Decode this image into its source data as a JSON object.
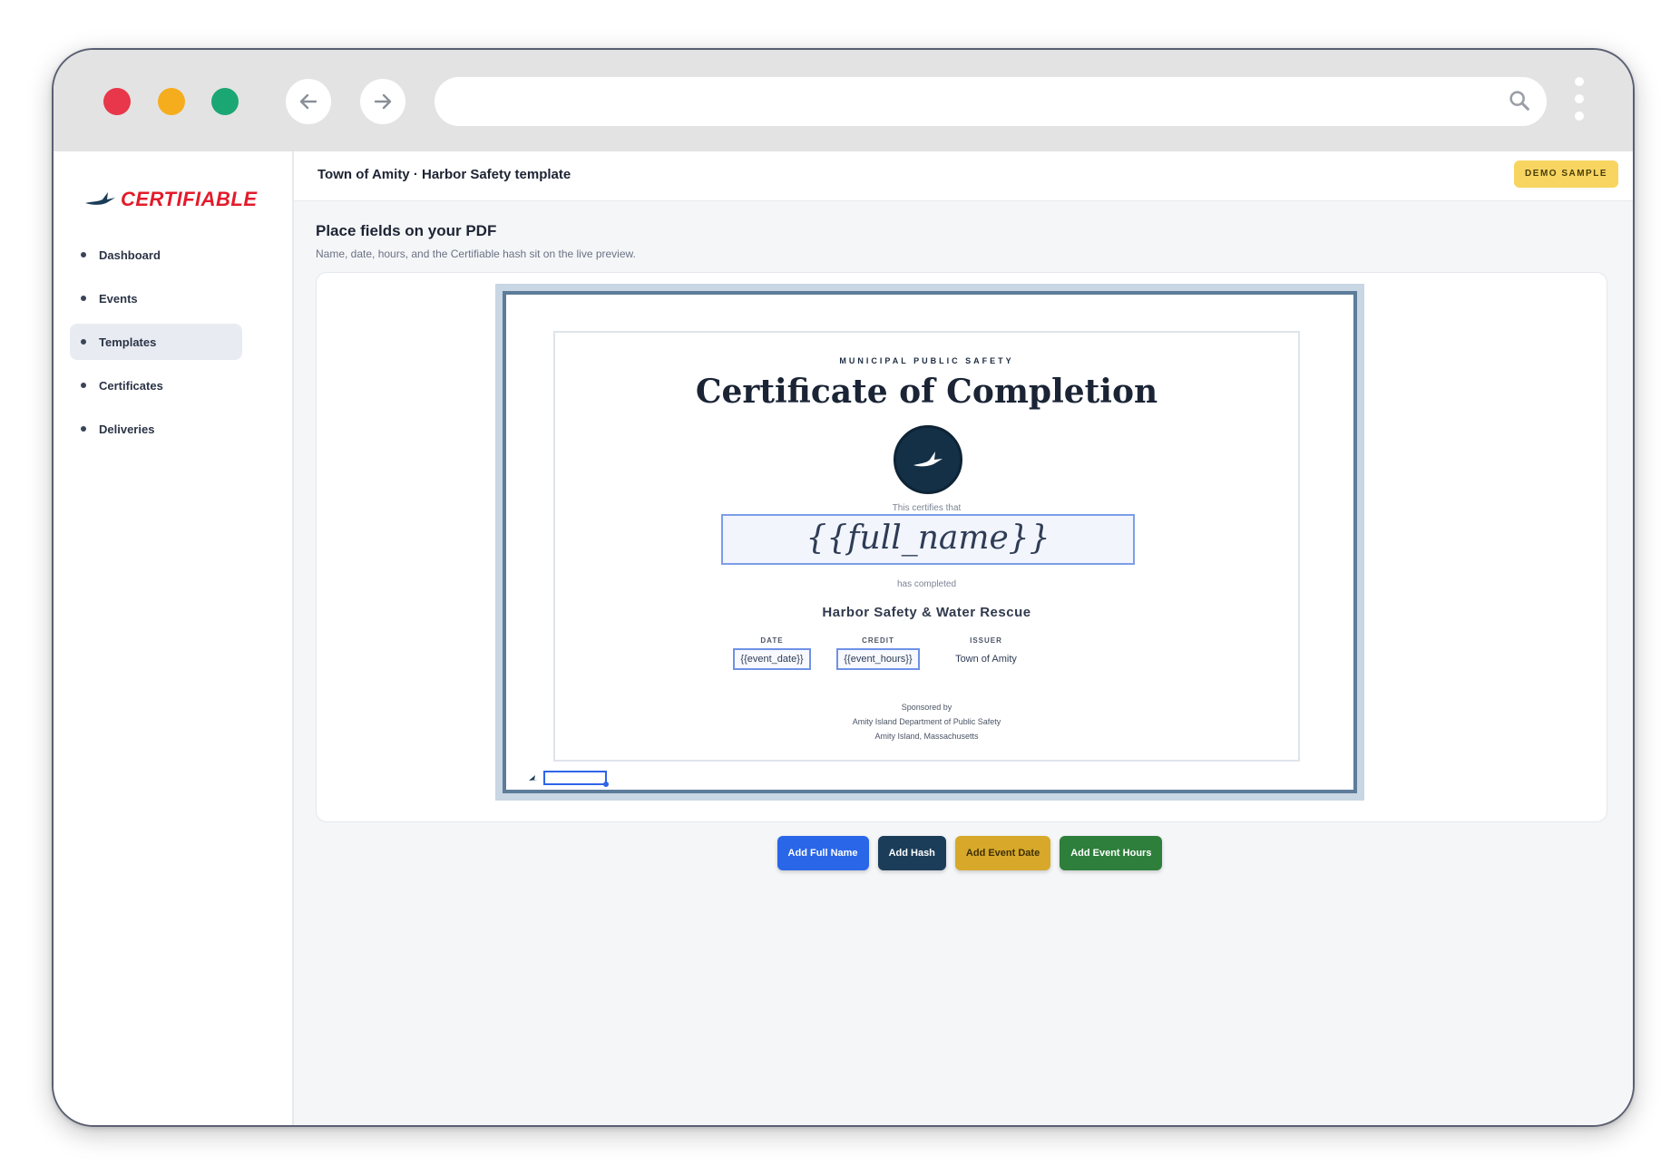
{
  "app": {
    "logo_text": "CERTIFIABLE",
    "brand_color": "#e21b2b"
  },
  "sidebar": {
    "items": [
      {
        "label": "Dashboard",
        "active": false
      },
      {
        "label": "Events",
        "active": false
      },
      {
        "label": "Templates",
        "active": true
      },
      {
        "label": "Certificates",
        "active": false
      },
      {
        "label": "Deliveries",
        "active": false
      }
    ]
  },
  "header": {
    "title": "Town of Amity · Harbor Safety template",
    "badge": "DEMO SAMPLE"
  },
  "main": {
    "title": "Place fields on your PDF",
    "subtitle": "Name, date, hours, and the Certifiable hash sit on the live preview."
  },
  "certificate": {
    "eyebrow": "MUNICIPAL PUBLIC SAFETY",
    "title": "Certificate of Completion",
    "certifies": "This certifies that",
    "name_field": "{{full_name}}",
    "completed": "has completed",
    "course": "Harbor Safety & Water Rescue",
    "date_label": "DATE",
    "date_field": "{{event_date}}",
    "credit_label": "CREDIT",
    "hours_field": "{{event_hours}}",
    "issuer_label": "ISSUER",
    "issuer_value": "Town of Amity",
    "sponsored_by": "Sponsored by",
    "sponsor_line1": "Amity Island Department of Public Safety",
    "sponsor_line2": "Amity Island, Massachusetts"
  },
  "actions": {
    "add_full_name": "Add Full Name",
    "add_hash": "Add Hash",
    "add_event_date": "Add Event Date",
    "add_event_hours": "Add Event Hours"
  }
}
